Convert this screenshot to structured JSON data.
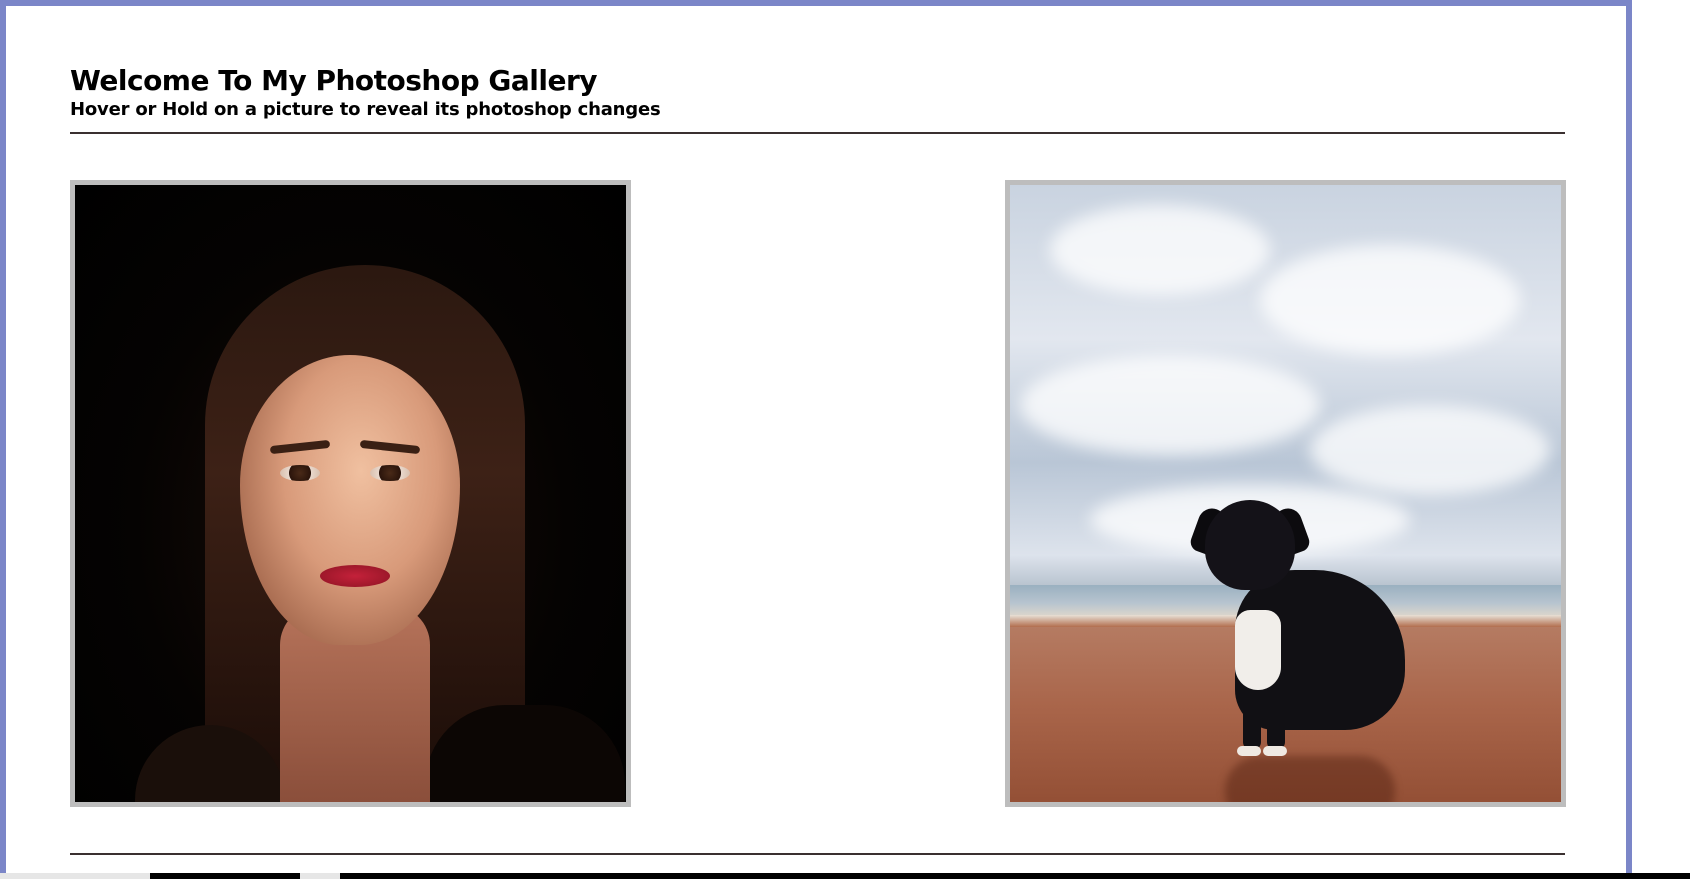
{
  "header": {
    "title": "Welcome To My Photoshop Gallery",
    "subtitle": "Hover or Hold on a picture to reveal its photoshop changes"
  },
  "gallery": {
    "items": [
      {
        "subject": "portrait of a woman with dark hair and red lips"
      },
      {
        "subject": "black and white dog sitting on a beach"
      }
    ]
  },
  "colors": {
    "frame_border": "#7b86c8",
    "rule": "#3a3030",
    "photo_border": "#bdbdbd",
    "text": "#000000"
  }
}
